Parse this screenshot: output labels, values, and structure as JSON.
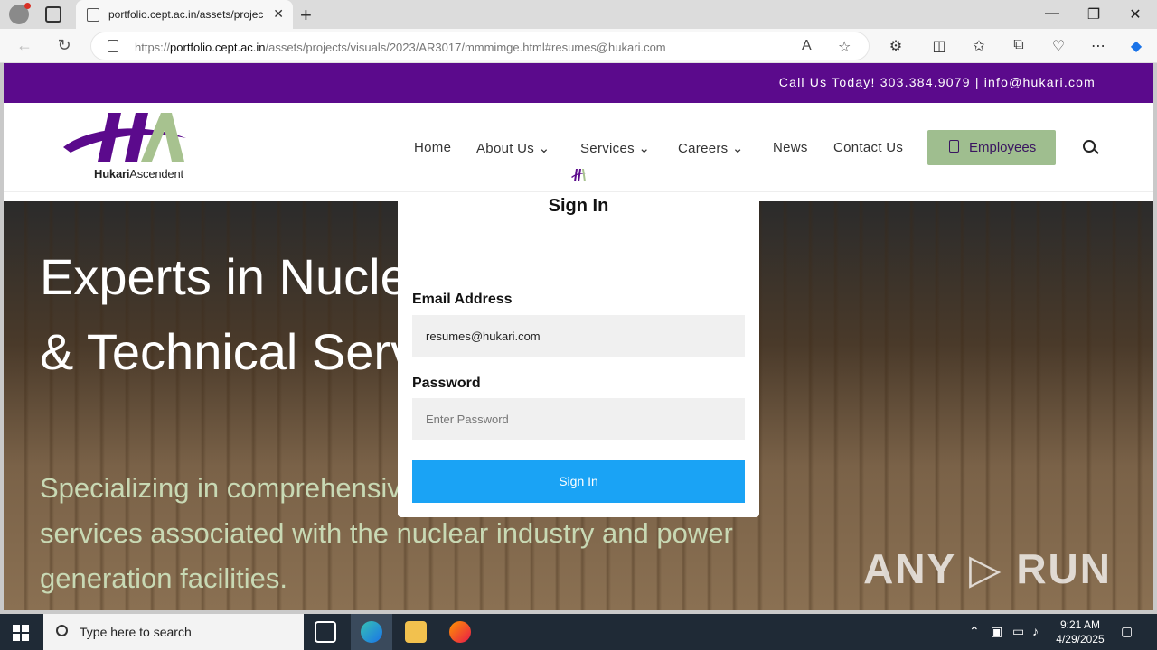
{
  "browser": {
    "tab_title": "portfolio.cept.ac.in/assets/projec",
    "tab_close": "✕",
    "new_tab": "+",
    "url_prefix": "https://",
    "url_host": "portfolio.cept.ac.in",
    "url_path": "/assets/projects/visuals/2023/AR3017/mmmimge.html#resumes@hukari.com"
  },
  "site": {
    "topbar_contact": "Call Us Today!  303.384.9079 | info@hukari.com",
    "logo_brand_bold": "Hukari",
    "logo_brand_rest": "Ascendent",
    "nav": {
      "home": "Home",
      "about": "About Us",
      "services": "Services",
      "careers": "Careers",
      "news": "News",
      "contact": "Contact Us",
      "employees": "Employees"
    },
    "hero": {
      "heading": "Experts in Nuclear Professional & Technical Services",
      "subheading": "Specializing in comprehensive professional and technical services associated with the nuclear industry and power generation facilities."
    },
    "watermark": "ANY ▷ RUN"
  },
  "signin": {
    "title": "Sign In",
    "email_label": "Email Address",
    "email_value": "resumes@hukari.com",
    "password_label": "Password",
    "password_placeholder": "Enter Password",
    "button_label": "Sign In"
  },
  "taskbar": {
    "search_text": "Type here to search",
    "time": "9:21 AM",
    "date": "4/29/2025"
  },
  "colors": {
    "topbar": "#5b0a8c",
    "employees_button": "#9fbe8f",
    "signin_button": "#1aa3f5",
    "hero_sub": "#c8d9b4"
  }
}
